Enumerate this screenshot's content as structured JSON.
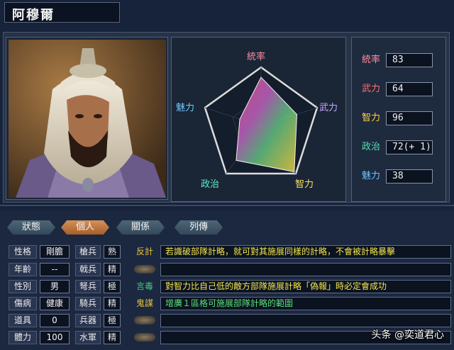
{
  "header": {
    "name": "阿穆爾"
  },
  "radar": {
    "labels": {
      "top": "統率",
      "right": "武力",
      "bottom_right": "智力",
      "bottom_left": "政治",
      "left": "魅力"
    },
    "label_colors": {
      "top": "#ff8fa0",
      "right": "#c8a8ff",
      "bottom_right": "#ffe060",
      "bottom_left": "#60f0c8",
      "left": "#70c8ff"
    }
  },
  "stats": [
    {
      "label": "統率",
      "value": "83",
      "color": "#ff8fa0"
    },
    {
      "label": "武力",
      "value": "64",
      "color": "#ff7070"
    },
    {
      "label": "智力",
      "value": "96",
      "color": "#ffd048"
    },
    {
      "label": "政治",
      "value": "72(+ 1)",
      "color": "#50e0b0"
    },
    {
      "label": "魅力",
      "value": "38",
      "color": "#70c0ff"
    }
  ],
  "tabs": [
    {
      "label": "狀態",
      "active": false
    },
    {
      "label": "個人",
      "active": true
    },
    {
      "label": "關係",
      "active": false
    },
    {
      "label": "列傳",
      "active": false
    }
  ],
  "attributes": [
    {
      "label": "性格",
      "value": "剛膽"
    },
    {
      "label": "年齡",
      "value": "--"
    },
    {
      "label": "性別",
      "value": "男"
    },
    {
      "label": "傷病",
      "value": "健康"
    },
    {
      "label": "道具",
      "value": "0"
    },
    {
      "label": "體力",
      "value": "100"
    }
  ],
  "troops": [
    {
      "label": "槍兵",
      "grade": "熟"
    },
    {
      "label": "戟兵",
      "grade": "精"
    },
    {
      "label": "弩兵",
      "grade": "極"
    },
    {
      "label": "騎兵",
      "grade": "精"
    },
    {
      "label": "兵器",
      "grade": "極"
    },
    {
      "label": "水軍",
      "grade": "精"
    }
  ],
  "skills": [
    {
      "name": "反計",
      "desc": "若識破部隊計略，就可對其施展同樣的計略，不會被計略暴擊",
      "name_color": "#e8c23a",
      "desc_color": "#f2e64a"
    },
    {
      "name": "",
      "desc": "",
      "name_color": "",
      "desc_color": ""
    },
    {
      "name": "言毒",
      "desc": "對智力比自己低的敵方部隊施展計略「偽報」時必定會成功",
      "name_color": "#3fd07a",
      "desc_color": "#f2e64a"
    },
    {
      "name": "鬼謀",
      "desc": "增廣１區格可施展部隊計略的範圍",
      "name_color": "#e8c23a",
      "desc_color": "#59e07a"
    },
    {
      "name": "",
      "desc": "",
      "name_color": "",
      "desc_color": ""
    },
    {
      "name": "",
      "desc": "",
      "name_color": "",
      "desc_color": ""
    }
  ],
  "watermark": "头条 @奕道君心"
}
